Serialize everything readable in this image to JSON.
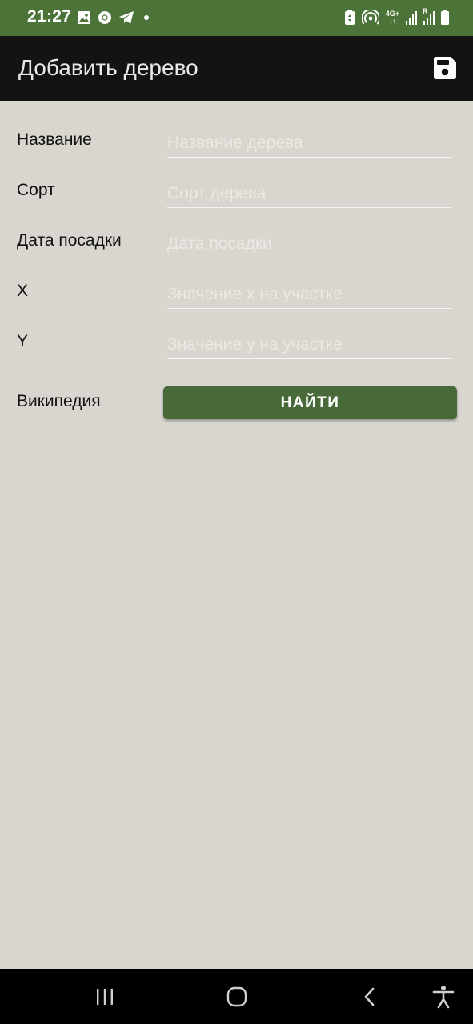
{
  "status_bar": {
    "time": "21:27",
    "left_icons": [
      "image-icon",
      "chrome-icon",
      "telegram-icon",
      "notification-dot-icon"
    ],
    "right_icons": [
      "battery-saver-icon",
      "hotspot-icon",
      "network-4g-icon",
      "signal-icon",
      "signal-roaming-icon",
      "battery-icon"
    ],
    "network_label": "4G+",
    "roaming_label": "R"
  },
  "app_bar": {
    "title": "Добавить дерево",
    "save_icon": "save-icon"
  },
  "form": {
    "fields": [
      {
        "label": "Название",
        "placeholder": "Название дерева",
        "value": ""
      },
      {
        "label": "Сорт",
        "placeholder": "Сорт дерева",
        "value": ""
      },
      {
        "label": "Дата посадки",
        "placeholder": "Дата посадки",
        "value": ""
      },
      {
        "label": "X",
        "placeholder": "Значение x на участке",
        "value": ""
      },
      {
        "label": "Y",
        "placeholder": "Значение y на участке",
        "value": ""
      }
    ],
    "wiki": {
      "label": "Википедия",
      "button_label": "НАЙТИ"
    }
  },
  "nav_bar": {
    "items": [
      "recent-apps-icon",
      "home-icon",
      "back-icon",
      "accessibility-icon"
    ]
  },
  "colors": {
    "status_bar": "#4c7439",
    "app_bar": "#131313",
    "background": "#d9d6d0",
    "button": "#476a38",
    "nav_bar": "#000000"
  }
}
